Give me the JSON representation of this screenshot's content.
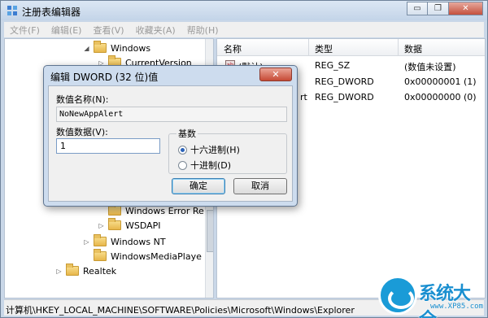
{
  "window": {
    "title": "注册表编辑器",
    "minimize_glyph": "▭",
    "restore_glyph": "❐",
    "close_glyph": "✕"
  },
  "menu": [
    "文件(F)",
    "编辑(E)",
    "查看(V)",
    "收藏夹(A)",
    "帮助(H)"
  ],
  "tree": {
    "items": [
      {
        "label": "Windows",
        "expander": "◢"
      },
      {
        "label": "CurrentVersion",
        "expander": "▷"
      },
      {
        "label": "Windows Error Re",
        "expander": ""
      },
      {
        "label": "WSDAPI",
        "expander": "▷"
      },
      {
        "label": "Windows NT",
        "expander": "▷"
      },
      {
        "label": "WindowsMediaPlaye",
        "expander": ""
      },
      {
        "label": "Realtek",
        "expander": "▷"
      }
    ]
  },
  "list": {
    "columns": [
      "名称",
      "类型",
      "数据"
    ],
    "rows": [
      {
        "name": "(默认)",
        "type": "REG_SZ",
        "data": "(数值未设置)",
        "icon": "string-value-icon"
      },
      {
        "name": "",
        "type": "REG_DWORD",
        "data": "0x00000001 (1)",
        "icon": "dword-value-icon"
      },
      {
        "name": "rt",
        "type": "REG_DWORD",
        "data": "0x00000000 (0)",
        "icon": "dword-value-icon"
      }
    ]
  },
  "status": "计算机\\HKEY_LOCAL_MACHINE\\SOFTWARE\\Policies\\Microsoft\\Windows\\Explorer",
  "dialog": {
    "title": "编辑 DWORD (32 位)值",
    "close_glyph": "✕",
    "name_label": "数值名称(N):",
    "name_value": "NoNewAppAlert",
    "data_label": "数值数据(V):",
    "data_value": "1",
    "base_label": "基数",
    "radio_hex": "十六进制(H)",
    "radio_dec": "十进制(D)",
    "selected_base": "hex",
    "ok": "确定",
    "cancel": "取消"
  },
  "watermark": {
    "brand": "系统大全",
    "url": "www.XP85.com"
  },
  "colors": {
    "accent": "#1a9bd7",
    "frame": "#c9d7e8",
    "close": "#c64a35"
  }
}
